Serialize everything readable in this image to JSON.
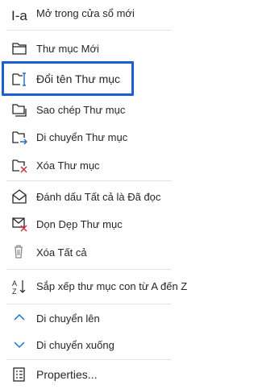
{
  "menu": {
    "items": [
      {
        "name": "open-in-new-window",
        "label": "Mở trong cửa sổ mới",
        "icon": "open-new-window-icon"
      },
      {
        "name": "new-folder",
        "label": "Thư mục Mới",
        "icon": "new-folder-icon"
      },
      {
        "name": "rename-folder",
        "label": "Đổi tên Thư mục",
        "icon": "rename-icon"
      },
      {
        "name": "copy-folder",
        "label": "Sao chép Thư mục",
        "icon": "copy-folder-icon"
      },
      {
        "name": "move-folder",
        "label": "Di chuyển Thư mục",
        "icon": "move-folder-icon"
      },
      {
        "name": "delete-folder",
        "label": "Xóa Thư mục",
        "icon": "delete-folder-icon"
      },
      {
        "name": "mark-all-read",
        "label": "Đánh dấu Tất cả là Đã đọc",
        "icon": "mark-read-icon"
      },
      {
        "name": "clean-up-folder",
        "label": "Dọn Dẹp Thư mục",
        "icon": "clean-up-icon"
      },
      {
        "name": "delete-all",
        "label": "Xóa Tất cả",
        "icon": "delete-all-icon"
      },
      {
        "name": "sort-subfolders",
        "label": "Sắp xếp thư mục con từ A đến Z",
        "icon": "sort-az-icon"
      },
      {
        "name": "move-up",
        "label": "Di chuyển lên",
        "icon": "chevron-up-icon"
      },
      {
        "name": "move-down",
        "label": "Di chuyển xuống",
        "icon": "chevron-down-icon"
      },
      {
        "name": "properties",
        "label": "Properties...",
        "icon": "properties-icon"
      }
    ]
  },
  "colors": {
    "highlight_border": "#1a5fd1",
    "accent_blue": "#1f6fd0",
    "delete_red": "#d13438"
  }
}
